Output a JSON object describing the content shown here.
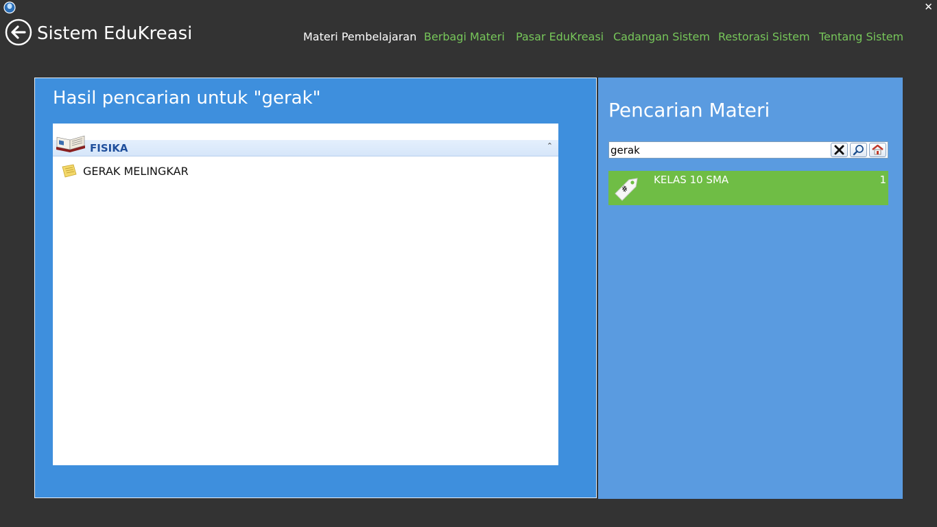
{
  "window": {
    "title": "Sistem EduKreasi",
    "close_glyph": "✕"
  },
  "nav": {
    "items": [
      {
        "label": "Materi Pembelajaran",
        "active": true
      },
      {
        "label": "Berbagi Materi",
        "active": false
      },
      {
        "label": "Pasar EduKreasi",
        "active": false
      },
      {
        "label": "Cadangan Sistem",
        "active": false
      },
      {
        "label": "Restorasi Sistem",
        "active": false
      },
      {
        "label": "Tentang Sistem",
        "active": false
      }
    ]
  },
  "results": {
    "title": "Hasil pencarian untuk \"gerak\"",
    "groups": [
      {
        "name": "FISIKA",
        "icon": "book-icon",
        "collapse_glyph": "⌃",
        "items": [
          {
            "label": "GERAK MELINGKAR",
            "icon": "note-icon"
          }
        ]
      }
    ]
  },
  "search": {
    "title": "Pencarian Materi",
    "query": "gerak",
    "buttons": [
      "clear-icon",
      "search-icon",
      "home-icon"
    ]
  },
  "tags": [
    {
      "label": "KELAS 10 SMA",
      "count": "1",
      "icon": "tag-icon"
    }
  ],
  "colors": {
    "background": "#333333",
    "nav_active": "#ffffff",
    "nav_inactive": "#77c75a",
    "results_panel": "#3e8fdd",
    "search_panel": "#5a9be0",
    "tag_green": "#6fbd45",
    "group_label": "#1f4f9c"
  }
}
